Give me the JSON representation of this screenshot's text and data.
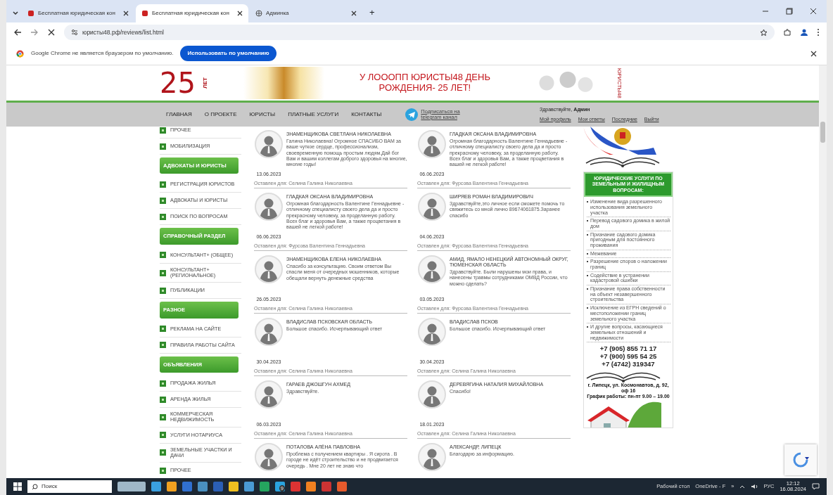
{
  "browser": {
    "tabs": [
      {
        "title": "Бесплатная юридическая кон",
        "selected": false
      },
      {
        "title": "Бесплатная юридическая кон",
        "selected": true
      },
      {
        "title": "Админка",
        "selected": false
      }
    ],
    "new_tab": "+",
    "url": "юристы48.рф/reviews/list.html"
  },
  "infobar": {
    "message": "Google Chrome не является браузером по умолчанию.",
    "button": "Использовать по умолчанию"
  },
  "banner": {
    "years": "25",
    "years_word": "ЛЕТ",
    "headline": "У ЛОООПП ЮРИСТЫ48 ДЕНЬ РОЖДЕНИЯ- 25 ЛЕТ!",
    "side_label": "ЮРИСТЫ48"
  },
  "nav": {
    "items": [
      "ГЛАВНАЯ",
      "О ПРОЕКТЕ",
      "ЮРИСТЫ",
      "ПЛАТНЫЕ УСЛУГИ",
      "КОНТАКТЫ"
    ],
    "telegram": "Подписаться на telegram канал",
    "greeting": "Здравствуйте, **Админ**",
    "user_links": [
      "Мой профиль",
      "Мои ответы",
      "Последние",
      "Выйти"
    ]
  },
  "sidebar": {
    "items": [
      {
        "kind": "link",
        "label": "ПРОЧЕЕ"
      },
      {
        "kind": "link",
        "label": "МОБИЛИЗАЦИЯ"
      },
      {
        "kind": "header",
        "label": "АДВОКАТЫ И ЮРИСТЫ"
      },
      {
        "kind": "link",
        "label": "РЕГИСТРАЦИЯ ЮРИСТОВ"
      },
      {
        "kind": "link",
        "label": "АДВОКАТЫ И ЮРИСТЫ"
      },
      {
        "kind": "link",
        "label": "ПОИСК ПО ВОПРОСАМ"
      },
      {
        "kind": "header",
        "label": "СПРАВОЧНЫЙ РАЗДЕЛ"
      },
      {
        "kind": "link",
        "label": "КОНСУЛЬТАНТ+ (ОБЩЕЕ)"
      },
      {
        "kind": "link",
        "label": "КОНСУЛЬТАНТ+ (РЕГИОНАЛЬНОЕ)"
      },
      {
        "kind": "link",
        "label": "ПУБЛИКАЦИИ"
      },
      {
        "kind": "header",
        "label": "РАЗНОЕ"
      },
      {
        "kind": "link",
        "label": "РЕКЛАМА НА САЙТЕ"
      },
      {
        "kind": "link",
        "label": "ПРАВИЛА РАБОТЫ САЙТА"
      },
      {
        "kind": "header",
        "label": "ОБЪЯВЛЕНИЯ"
      },
      {
        "kind": "link",
        "label": "ПРОДАЖА ЖИЛЬЯ"
      },
      {
        "kind": "link",
        "label": "АРЕНДА ЖИЛЬЯ"
      },
      {
        "kind": "link",
        "label": "КОММЕРЧЕСКАЯ НЕДВИЖИМОСТЬ"
      },
      {
        "kind": "link",
        "label": "УСЛУГИ НОТАРИУСА"
      },
      {
        "kind": "link",
        "label": "ЗЕМЕЛЬНЫЕ УЧАСТКИ И ДАЧИ"
      },
      {
        "kind": "link",
        "label": "ПРОЧЕЕ"
      }
    ]
  },
  "reviews": [
    {
      "author": "ЗНАМЕНЩИКОВА СВЕТЛАНА НИКОЛАЕВНА",
      "text": "Галина Николаевна! Огромное СПАСИБО ВАМ за ваше чуткое сердце, профессионализм, своевременную помощь простым людям.Дай бог Вам и вашим коллегам доброго здоровья на многие, многие годы!",
      "date": "13.06.2023",
      "for_label": "Оставлен для:",
      "for_name": "Селина Галина Николаевна"
    },
    {
      "author": "ГЛАДКАЯ ОКСАНА ВЛАДИМИРОВНА",
      "text": "Огромная благодарность Валентине Геннадьевне - отличному специалисту своего дела да и просто прекрасному человеку, за проделанную работу. Всех благ и здоровья Вам, а также процветания в вашей не легкой работе!",
      "date": "06.06.2023",
      "for_label": "Оставлен для:",
      "for_name": "Фурсова Валентина Геннадьевна"
    },
    {
      "author": "ГЛАДКАЯ ОКСАНА ВЛАДИМИРОВНА",
      "text": "Огромная благодарность Валентине Геннадьевне - отличному специалисту своего дела да и просто прекрасному человеку, за проделанную работу. Всех благ и здоровья Вам, а также процветания в вашей не легкой работе!",
      "date": "06.06.2023",
      "for_label": "Оставлен для:",
      "for_name": "Фурсова Валентина Геннадьевна"
    },
    {
      "author": "ШИРЯЕВ РОМАН ВЛАДИМИРОВИЧ",
      "text": "Здравствуйте,это личное если сможете помочь то свяжитесь со мной лично 89674061875.Заранее спасибо",
      "date": "04.06.2023",
      "for_label": "Оставлен для:",
      "for_name": "Фурсова Валентина Геннадьевна"
    },
    {
      "author": "ЗНАМЕНЩИКОВА ЕЛЕНА НИКОЛАЕВНА",
      "text": "Спасибо за консультацию. Своим ответом Вы спасли меня от очередных мошенников, которые обещали вернуть денежные средства",
      "date": "26.05.2023",
      "for_label": "Оставлен для:",
      "for_name": "Селина Галина Николаевна"
    },
    {
      "author": "АМИД, ЯМАЛО НЕНЕЦКИЙ АВТОНОМНЫЙ ОКРУГ, ТЮМЕНСКАЯ ОБЛАСТЬ",
      "text": "Здравствуйте. Были нарушены мои права, и нанесены травмы сотрудниками ОМВД России, что можно сделать?",
      "date": "03.05.2023",
      "for_label": "Оставлен для:",
      "for_name": "Фурсова Валентина Геннадьевна"
    },
    {
      "author": "ВЛАДИСЛАВ ПСКОВСКАЯ ОБЛАСТЬ",
      "text": "Большое спасибо. Исчерпывающий ответ",
      "date": "30.04.2023",
      "for_label": "Оставлен для:",
      "for_name": "Селина Галина Николаевна"
    },
    {
      "author": "ВЛАДИСЛАВ ПСКОВ",
      "text": "Большое спасибо. Исчерпывающий ответ",
      "date": "30.04.2023",
      "for_label": "Оставлен для:",
      "for_name": "Селина Галина Николаевна"
    },
    {
      "author": "ГАРАЕВ ДЖОШГУН АХМЕД",
      "text": "Здравствуйте.",
      "date": "06.03.2023",
      "for_label": "Оставлен для:",
      "for_name": "Селина Галина Николаевна"
    },
    {
      "author": "ДЕРЕВЯГИНА НАТАЛИЯ МИХАЙЛОВНА",
      "text": "Спасибо!",
      "date": "18.01.2023",
      "for_label": "Оставлен для:",
      "for_name": "Селина Галина Николаевна"
    },
    {
      "author": "ПОТАЛОВА АЛЁНА ПАВЛОВНА",
      "text": "Проблема с получением квартиры . Я сирота . В городе не идёт строительство и не продвигается очередь . Мне 20 лет не знаю что"
    },
    {
      "author": "АЛЕКСАНДР, ЛИПЕЦК",
      "text": "Благодарю за информацию."
    }
  ],
  "services": {
    "title": "ЮРИДИЧЕСКИЕ УСЛУГИ ПО ЗЕМЕЛЬНЫМ И ЖИЛИЩНЫМ ВОПРОСАМ:",
    "items": [
      "Изменение вида разрешенного использования земельного участка",
      "Перевод садового домика в жилой дом",
      "Признание садового домика пригодным для постоянного проживания",
      "Межевание",
      "Разрешение споров о наложении границ",
      "Содействие в устранении кадастровой ошибки",
      "Признание права собственности на объект незавершенного строительства",
      "Исключение из ЕГРН сведений о местоположении границ земельного участка",
      "И другие вопросы, касающиеся земельных отношений и недвижимости"
    ],
    "phones": [
      "+7 (905) 855 71 17",
      "+7 (900) 595 54 25",
      "+7 (4742) 319347"
    ],
    "address": "г. Липецк, ул. Космонавтов, д. 92, оф 16",
    "hours": "График работы: пн-пт 9.00 – 19.00"
  },
  "taskbar": {
    "search": "Поиск",
    "badge": "9",
    "desktop": "Рабочий стол",
    "onedrive": "OneDrive - F",
    "overflow": "»",
    "language": "РУС",
    "time": "12:12",
    "date": "16.08.2024"
  }
}
